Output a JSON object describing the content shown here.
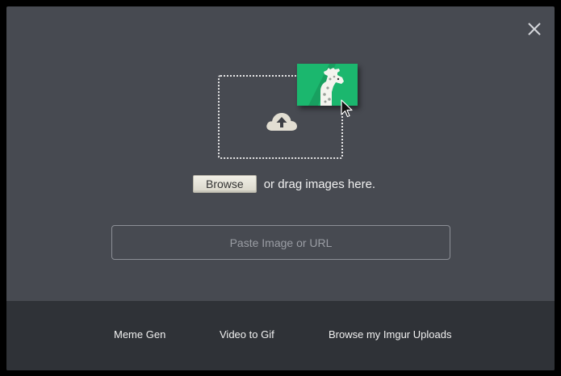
{
  "dialog": {
    "close_icon": "close-icon"
  },
  "upload": {
    "cloud_icon": "cloud-upload-icon",
    "tile_icon": "giraffe-icon",
    "tile_color": "#1bb76e",
    "cursor_icon": "cursor-arrow-icon",
    "browse_label": "Browse",
    "drag_text": "or drag images here.",
    "url_placeholder": "Paste Image or URL",
    "url_value": ""
  },
  "footer": {
    "links": [
      {
        "label": "Meme Gen"
      },
      {
        "label": "Video to Gif"
      },
      {
        "label": "Browse my Imgur Uploads"
      }
    ]
  },
  "colors": {
    "modal_bg": "#474a51",
    "footer_bg": "#2f3237",
    "accent_green": "#1bb76e"
  }
}
